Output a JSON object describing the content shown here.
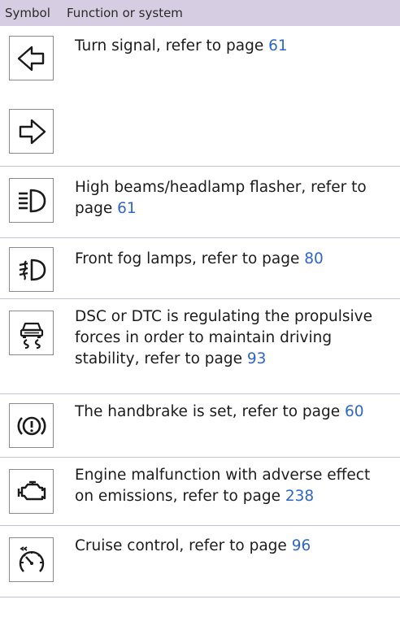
{
  "header": {
    "col_symbol": "Symbol",
    "col_function": "Function or system"
  },
  "link_color": "#2f66c8",
  "rows": [
    {
      "icon": "turn-signal-left-icon",
      "text": "Turn signal, refer to page ",
      "page": "61"
    },
    {
      "icon": "turn-signal-right-icon",
      "text": "",
      "page": ""
    },
    {
      "icon": "high-beam-icon",
      "text": "High beams/headlamp flasher, refer to page ",
      "page": "61"
    },
    {
      "icon": "front-fog-lamp-icon",
      "text": "Front fog lamps, refer to page ",
      "page": "80"
    },
    {
      "icon": "dsc-dtc-icon",
      "text": "DSC or DTC is regulating the propulsive forces in order to maintain driving stability, refer to page ",
      "page": "93"
    },
    {
      "icon": "handbrake-icon",
      "text": "The handbrake is set, refer to page ",
      "page": "60"
    },
    {
      "icon": "engine-malfunction-icon",
      "text": "Engine malfunction with adverse effect on emissions, refer to page ",
      "page": "238"
    },
    {
      "icon": "cruise-control-icon",
      "text": "Cruise control, refer to page ",
      "page": "96"
    }
  ]
}
